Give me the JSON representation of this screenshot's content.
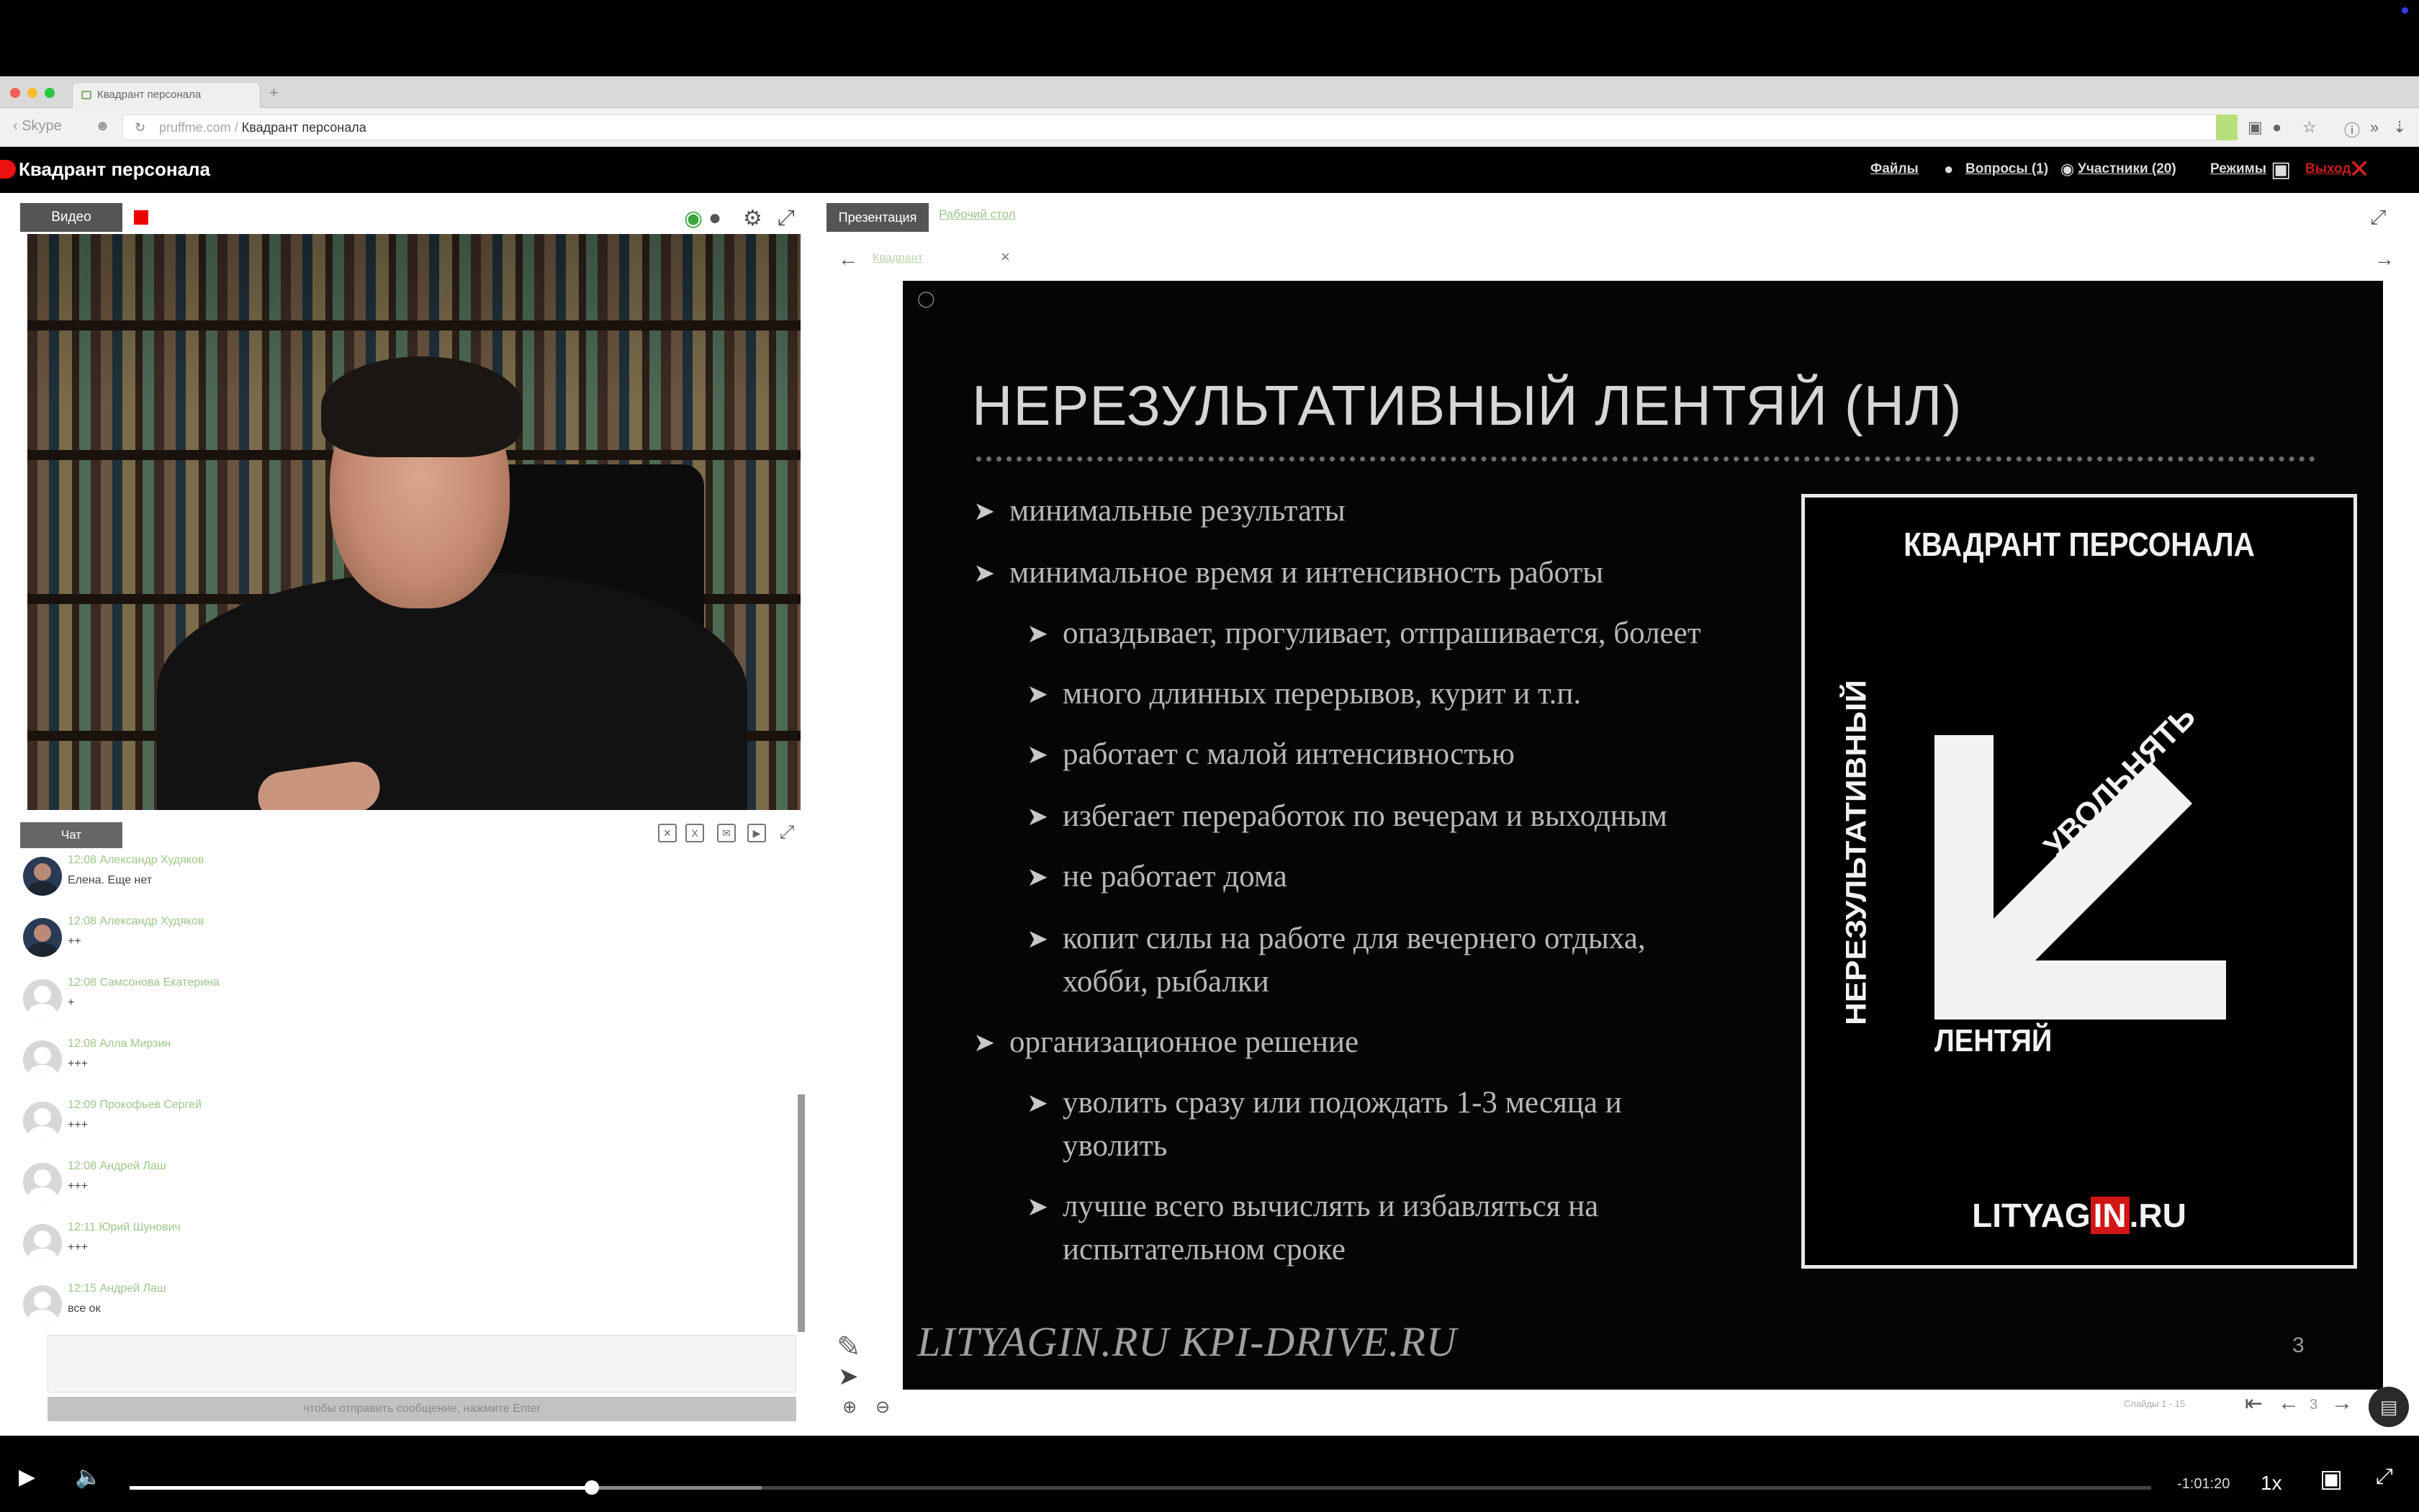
{
  "browser": {
    "tab_title": "Квадрант персонала",
    "new_tab": "+",
    "back_label": "Skype",
    "url_domain": "pruffme.com",
    "url_sep": "/",
    "url_path": "Квадрант персонала"
  },
  "header": {
    "title": "Квадрант персонала",
    "files": "Файлы",
    "questions": "Вопросы (1)",
    "participants": "Участники (20)",
    "modes": "Режимы",
    "exit": "Выход"
  },
  "video": {
    "tab_label": "Видео"
  },
  "chat": {
    "tab_label": "Чат",
    "messages": [
      {
        "time": "12:08",
        "author": "Александр Худяков",
        "text": "Елена. Еще нет",
        "photo": true
      },
      {
        "time": "12:08",
        "author": "Александр Худяков",
        "text": "++",
        "photo": true
      },
      {
        "time": "12:08",
        "author": "Самсонова Екатерина",
        "text": "+",
        "photo": false
      },
      {
        "time": "12:08",
        "author": "Алла Мирзин",
        "text": "+++",
        "photo": false
      },
      {
        "time": "12:09",
        "author": "Прокофьев Сергей",
        "text": "+++",
        "photo": false
      },
      {
        "time": "12:08",
        "author": "Андрей Лаш",
        "text": "+++",
        "photo": false
      },
      {
        "time": "12:11",
        "author": "Юрий Шунович",
        "text": "+++",
        "photo": false
      },
      {
        "time": "12:15",
        "author": "Андрей Лаш",
        "text": "все ок",
        "photo": false
      }
    ],
    "send_hint": "чтобы отправить сообщение, нажмите Enter"
  },
  "presentation": {
    "tab_label": "Презентация",
    "desktop_tab": "Рабочий стол",
    "doc_tab": "Квадрант",
    "slide": {
      "title": "НЕРЕЗУЛЬТАТИВНЫЙ ЛЕНТЯЙ (НЛ)",
      "b1": "минимальные результаты",
      "b2": "минимальное время и интенсивность работы",
      "b2_1": "опаздывает, прогуливает, отпрашивается, болеет",
      "b2_2": "много длинных перерывов, курит и т.п.",
      "b2_3": "работает с малой интенсивностью",
      "b2_4": "избегает переработок по вечерам и выходным",
      "b2_5": "не работает дома",
      "b2_6a": "копит силы на работе для вечернего отдыха,",
      "b2_6b": "хобби, рыбалки",
      "b3": "организационное решение",
      "b3_1a": "уволить сразу или подождать 1-3 месяца и",
      "b3_1b": "уволить",
      "b3_2a": "лучше всего вычислять и избавляться на",
      "b3_2b": "испытательном сроке",
      "footer": "LITYAGIN.RU  KPI-DRIVE.RU",
      "number": "3",
      "book_title": "КВАДРАНТ ПЕРСОНАЛА",
      "book_vertical": "НЕРЕЗУЛЬТАТИВНЫЙ",
      "book_bottom": "ЛЕНТЯЙ",
      "book_diag": "УВОЛЬНЯТЬ",
      "book_logo_a": "LITYAG",
      "book_logo_b": "IN",
      "book_logo_c": ".RU"
    },
    "slide_counter": "Слайды 1 - 15",
    "page": "3"
  },
  "player": {
    "time_left": "-1:01:20",
    "speed": "1x",
    "progress": 0.2285,
    "buffered": 0.3127
  },
  "colors": {
    "accent_green": "#9cc78a",
    "record_red": "#e00000",
    "slide_bg": "#050505"
  }
}
